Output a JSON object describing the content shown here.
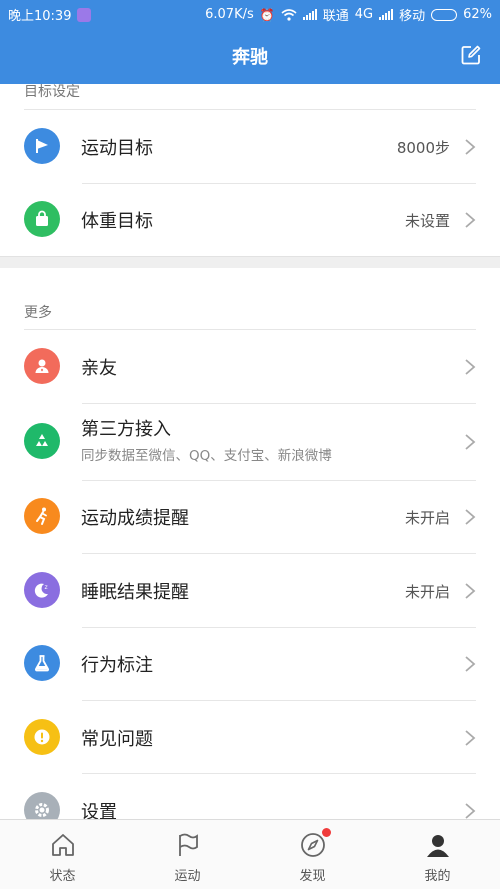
{
  "status_bar": {
    "time": "晚上10:39",
    "speed": "6.07K/s",
    "carrier1": "联通",
    "network": "4G",
    "carrier2": "移动",
    "battery": "62%",
    "battery_level": 0.62
  },
  "header": {
    "title": "奔驰",
    "background": "#3d8be0",
    "edit_icon": "edit-icon"
  },
  "goals": {
    "section_label": "目标设定",
    "items": [
      {
        "title": "运动目标",
        "value": "8000步",
        "icon": "flag-icon",
        "color": "#3d8be0"
      },
      {
        "title": "体重目标",
        "value": "未设置",
        "icon": "bag-icon",
        "color": "#2fbe62"
      }
    ]
  },
  "more": {
    "section_label": "更多",
    "items": [
      {
        "title": "亲友",
        "subtitle": "",
        "value": "",
        "icon": "friends-icon",
        "color": "#f26b5b"
      },
      {
        "title": "第三方接入",
        "subtitle": "同步数据至微信、QQ、支付宝、新浪微博",
        "value": "",
        "icon": "recycle-icon",
        "color": "#1fb96a"
      },
      {
        "title": "运动成绩提醒",
        "subtitle": "",
        "value": "未开启",
        "icon": "runner-icon",
        "color": "#f88a1e"
      },
      {
        "title": "睡眠结果提醒",
        "subtitle": "",
        "value": "未开启",
        "icon": "moon-icon",
        "color": "#8a6ee0"
      },
      {
        "title": "行为标注",
        "subtitle": "",
        "value": "",
        "icon": "flask-icon",
        "color": "#3d8be0"
      },
      {
        "title": "常见问题",
        "subtitle": "",
        "value": "",
        "icon": "alert-icon",
        "color": "#f6c014"
      },
      {
        "title": "设置",
        "subtitle": "",
        "value": "",
        "icon": "gear-icon",
        "color": "#a8b0b8"
      }
    ]
  },
  "tabbar": {
    "tabs": [
      {
        "label": "状态",
        "icon": "home-icon"
      },
      {
        "label": "运动",
        "icon": "flag-outline-icon"
      },
      {
        "label": "发现",
        "icon": "compass-icon",
        "badge": true
      },
      {
        "label": "我的",
        "icon": "profile-icon"
      }
    ]
  }
}
